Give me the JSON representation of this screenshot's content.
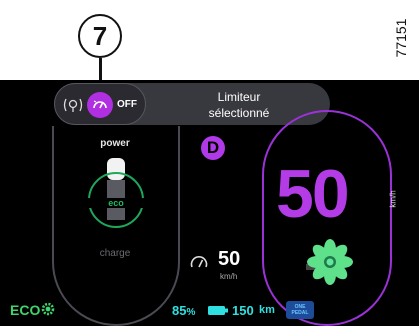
{
  "callout": {
    "number": "7",
    "reference": "77151"
  },
  "banner": {
    "status": "OFF",
    "message_line1": "Limiteur",
    "message_line2": "sélectionné",
    "limiter_icon": "speed-limiter-icon"
  },
  "gear": "D",
  "power_gauge": {
    "top_label": "power",
    "eco_label": "eco",
    "bottom_label": "charge"
  },
  "speed": {
    "value": "50",
    "unit": "km/h"
  },
  "limiter": {
    "value": "50",
    "unit": "km/h"
  },
  "footer": {
    "eco_label": "ECO",
    "battery_value": "85",
    "battery_unit": "%",
    "range_value": "150",
    "range_unit": "km",
    "one_pedal_label": "ONE PEDAL"
  },
  "colors": {
    "accent_purple": "#b33ce6",
    "eco_green": "#3fd56c",
    "cyan": "#2ee0e0",
    "background": "#000000"
  }
}
